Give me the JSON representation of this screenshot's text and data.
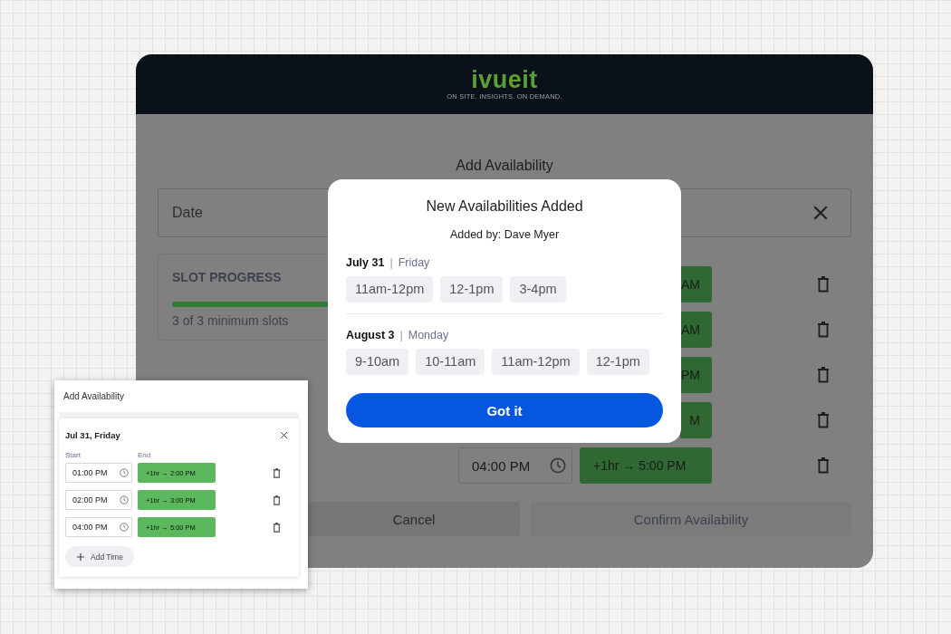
{
  "app": {
    "logo": "ivueit",
    "tagline": "ON SITE. INSIGHTS. ON DEMAND."
  },
  "page": {
    "title": "Add Availability",
    "date_field": {
      "placeholder": "Date"
    },
    "slot_progress": {
      "title": "SLOT PROGRESS",
      "level": 1,
      "caption": "3 of 3 minimum slots"
    },
    "rows": [
      {
        "kind": "partial",
        "end": "AM"
      },
      {
        "kind": "partial",
        "end": "AM"
      },
      {
        "kind": "partial",
        "end": "PM"
      },
      {
        "kind": "partial",
        "end": "M"
      },
      {
        "kind": "full",
        "start": "04:00 PM",
        "end": "+1hr → 5:00 PM"
      }
    ],
    "buttons": [
      {
        "label": "Cancel",
        "disabled": false
      },
      {
        "label": "Confirm Availability",
        "disabled": true
      }
    ]
  },
  "modal": {
    "title": "New Availabilities Added",
    "added_by": "Added by: Dave Myer",
    "days": [
      {
        "date": "July 31",
        "separator": "|",
        "weekday": "Friday",
        "slots": [
          "11am-12pm",
          "12-1pm",
          "3-4pm"
        ]
      },
      {
        "date": "August 3",
        "separator": "|",
        "weekday": "Monday",
        "slots": [
          "9-10am",
          "10-11am",
          "11am-12pm",
          "12-1pm"
        ]
      }
    ],
    "button": "Got it"
  },
  "inset": {
    "title": "Add Availability",
    "day": "Jul 31, Friday",
    "start_label": "Start",
    "end_label": "End",
    "rows": [
      {
        "start": "01:00 PM",
        "end": "+1hr → 2:00 PM"
      },
      {
        "start": "02:00 PM",
        "end": "+1hr → 3:00 PM"
      },
      {
        "start": "04:00 PM",
        "end": "+1hr → 5:00 PM"
      }
    ],
    "add_button": "Add Time"
  }
}
